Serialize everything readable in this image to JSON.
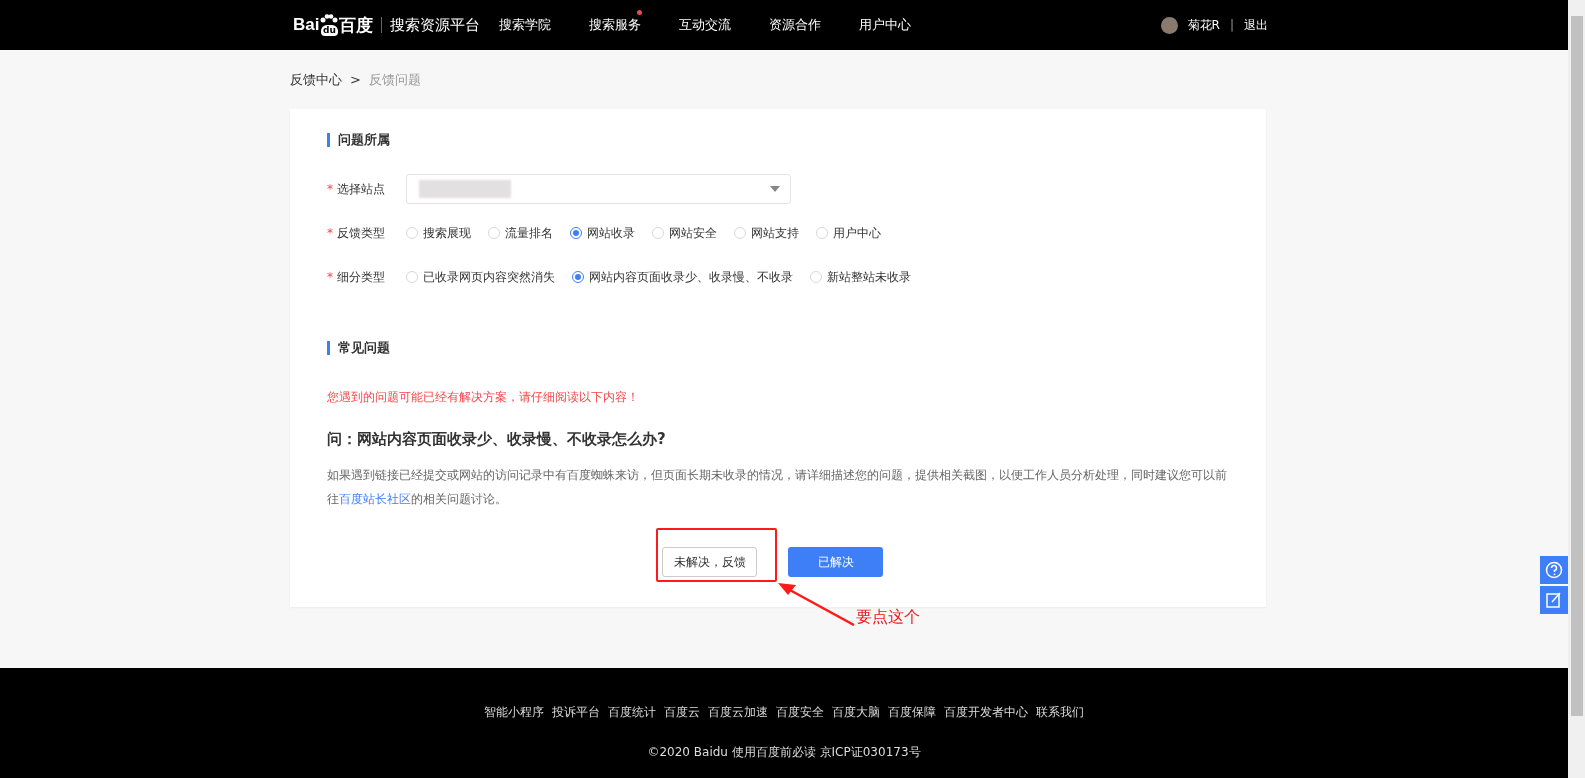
{
  "header": {
    "logo": {
      "part_1": "Bai",
      "part_2": "du",
      "part_3": "百度"
    },
    "platform_name": "搜索资源平台",
    "nav": [
      {
        "label": "搜索学院",
        "dot": false
      },
      {
        "label": "搜索服务",
        "dot": true
      },
      {
        "label": "互动交流",
        "dot": false
      },
      {
        "label": "资源合作",
        "dot": false
      },
      {
        "label": "用户中心",
        "dot": false
      }
    ],
    "user": {
      "name": "菊花R",
      "separator": "|",
      "logout": "退出"
    }
  },
  "breadcrumb": {
    "items": [
      "反馈中心",
      "反馈问题"
    ],
    "separator": ">"
  },
  "section_1": {
    "title": "问题所属",
    "fields": [
      {
        "kind": "select",
        "label": "选择站点",
        "required": "*"
      },
      {
        "kind": "radio",
        "label": "反馈类型",
        "required": "*",
        "options": [
          {
            "label": "搜索展现",
            "selected": false
          },
          {
            "label": "流量排名",
            "selected": false
          },
          {
            "label": "网站收录",
            "selected": true
          },
          {
            "label": "网站安全",
            "selected": false
          },
          {
            "label": "网站支持",
            "selected": false
          },
          {
            "label": "用户中心",
            "selected": false
          }
        ]
      },
      {
        "kind": "radio",
        "label": "细分类型",
        "required": "*",
        "options": [
          {
            "label": "已收录网页内容突然消失",
            "selected": false
          },
          {
            "label": "网站内容页面收录少、收录慢、不收录",
            "selected": true
          },
          {
            "label": "新站整站未收录",
            "selected": false
          }
        ]
      }
    ]
  },
  "section_2": {
    "title": "常见问题",
    "notice": "您遇到的问题可能已经有解决方案，请仔细阅读以下内容！",
    "question": "问：网站内容页面收录少、收录慢、不收录怎么办?",
    "answer": "如果遇到链接已经提交或网站的访问记录中有百度蜘蛛来访，但页面长期未收录的情况，请详细描述您的问题，提供相关截图，以便工作人员分析处理，同时建议您可以前往",
    "answer_link": "百度站长社区",
    "answer_end": "的相关问题讨论。"
  },
  "buttons": [
    {
      "label": "未解决，反馈",
      "kind": "secondary"
    },
    {
      "label": "已解决",
      "kind": "primary"
    }
  ],
  "annotation": {
    "text": "要点这个"
  },
  "footer": {
    "links": [
      "智能小程序",
      "投诉平台",
      "百度统计",
      "百度云",
      "百度云加速",
      "百度安全",
      "百度大脑",
      "百度保障",
      "百度开发者中心",
      "联系我们"
    ],
    "copyright": "©2020 Baidu 使用百度前必读 京ICP证030173号"
  }
}
